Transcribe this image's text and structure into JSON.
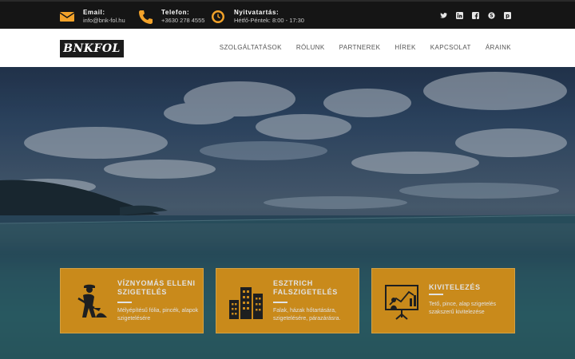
{
  "topbar": {
    "email": {
      "label": "Email:",
      "value": "info@bnk-fol.hu",
      "icon": "envelope-icon"
    },
    "phone": {
      "label": "Telefon:",
      "value": "+3630 278 4555",
      "icon": "phone-icon"
    },
    "hours": {
      "label": "Nyitvatartás:",
      "value": "Hétfő-Péntek: 8:00 - 17:30",
      "icon": "clock-icon"
    },
    "social": [
      "twitter-icon",
      "linkedin-icon",
      "facebook-icon",
      "skype-icon",
      "pinterest-icon"
    ],
    "accent": "#f2a22a"
  },
  "nav": {
    "logo": "BNKFOL",
    "items": [
      "SZOLGÁLTATÁSOK",
      "RÓLUNK",
      "PARTNEREK",
      "HÍREK",
      "KAPCSOLAT",
      "ÁRAINK"
    ]
  },
  "cards": [
    {
      "title": "VÍZNYOMÁS ELLENI SZIGETELÉS",
      "text": "Mélyépítésű fólia, pincék, alapok szigetelésére",
      "icon": "worker-digging-icon"
    },
    {
      "title": "ESZTRICH FALSZIGETELÉS",
      "text": "Falak, házak hőtartására, szigetelésére, párazárásra.",
      "icon": "buildings-icon"
    },
    {
      "title": "KIVITELEZÉS",
      "text": "Tető, pince, alap szigetelés szakszerű kivitelezése",
      "icon": "presentation-icon"
    }
  ],
  "colors": {
    "card": "#e49b1c",
    "topbar": "#151515"
  }
}
